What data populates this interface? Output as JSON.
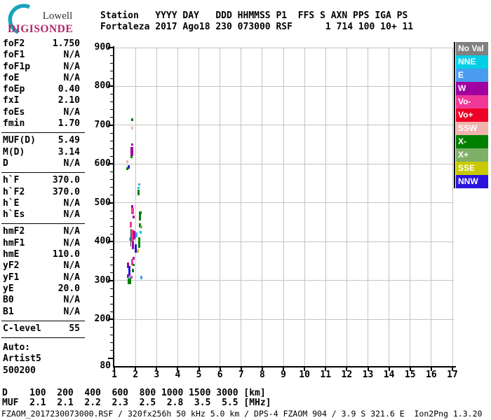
{
  "logo": {
    "line1": "Lowell",
    "line2": "DIGISONDE",
    "arc_color": "#1aa2bc",
    "digisonde_color": "#b02a68"
  },
  "header": {
    "line1": "Station   YYYY DAY   DDD HHMMSS P1  FFS S AXN PPS IGA PS",
    "line2": "Fortaleza 2017 Ago18 230 073000 RSF      1 714 100 10+ 11"
  },
  "params": {
    "groups": [
      {
        "rows": [
          {
            "label": "foF2",
            "value": "1.750"
          },
          {
            "label": "foF1",
            "value": "N/A"
          },
          {
            "label": "foF1p",
            "value": "N/A"
          },
          {
            "label": "foE",
            "value": "N/A"
          },
          {
            "label": "foEp",
            "value": "0.40"
          },
          {
            "label": "fxI",
            "value": "2.10"
          },
          {
            "label": "foEs",
            "value": "N/A"
          },
          {
            "label": "fmin",
            "value": "1.70"
          }
        ]
      },
      {
        "rows": [
          {
            "label": "MUF(D)",
            "value": "5.49"
          },
          {
            "label": "M(D)",
            "value": "3.14"
          },
          {
            "label": "D",
            "value": "N/A"
          }
        ]
      },
      {
        "rows": [
          {
            "label": "h`F",
            "value": "370.0"
          },
          {
            "label": "h`F2",
            "value": "370.0"
          },
          {
            "label": "h`E",
            "value": "N/A"
          },
          {
            "label": "h`Es",
            "value": "N/A"
          }
        ]
      },
      {
        "rows": [
          {
            "label": "hmF2",
            "value": "N/A"
          },
          {
            "label": "hmF1",
            "value": "N/A"
          },
          {
            "label": "hmE",
            "value": "110.0"
          },
          {
            "label": "yF2",
            "value": "N/A"
          },
          {
            "label": "yF1",
            "value": "N/A"
          },
          {
            "label": "yE",
            "value": "20.0"
          },
          {
            "label": "B0",
            "value": "N/A"
          },
          {
            "label": "B1",
            "value": "N/A"
          }
        ]
      },
      {
        "rows": [
          {
            "label": "C-level",
            "value": "55"
          }
        ]
      },
      {
        "rows": [
          {
            "label": "Auto:",
            "value": ""
          },
          {
            "label": "Artist5",
            "value": ""
          },
          {
            "label": "500200",
            "value": ""
          }
        ]
      }
    ]
  },
  "legend": {
    "items": [
      {
        "label": "No Val",
        "color": "#808080"
      },
      {
        "label": "NNE",
        "color": "#00cfe6"
      },
      {
        "label": "E",
        "color": "#4a9cf0"
      },
      {
        "label": "W",
        "color": "#a000a0"
      },
      {
        "label": "Vo-",
        "color": "#f03898"
      },
      {
        "label": "Vo+",
        "color": "#ef0028"
      },
      {
        "label": "SSW",
        "color": "#f0b3ad"
      },
      {
        "label": "X-",
        "color": "#008000"
      },
      {
        "label": "X+",
        "color": "#7fb068"
      },
      {
        "label": "SSE",
        "color": "#c9c900"
      },
      {
        "label": "NNW",
        "color": "#2a14dc"
      }
    ]
  },
  "footer": {
    "d_line": "D    100  200  400  600  800 1000 1500 3000 [km]",
    "muf_line": "MUF  2.1  2.1  2.2  2.3  2.5  2.8  3.5  5.5 [MHz]",
    "status_line": "FZAOM_2017230073000.RSF / 320fx256h 50 kHz 5.0 km / DPS-4 FZAOM 904 / 3.9 S 321.6 E  Ion2Png 1.3.20"
  },
  "chart_data": {
    "type": "scatter",
    "title": "Fortaleza ionogram 2017 Ago18 230 073000",
    "x_unit": "MHz",
    "y_unit": "km",
    "xlim": [
      1,
      17
    ],
    "ylim": [
      80,
      900
    ],
    "grid": true,
    "x_ticks": [
      1,
      2,
      3,
      4,
      5,
      6,
      7,
      8,
      9,
      10,
      11,
      12,
      13,
      14,
      15,
      16,
      17
    ],
    "y_ticks": [
      900,
      800,
      700,
      600,
      500,
      400,
      300,
      200,
      80
    ],
    "legend_position": "right",
    "colors": {
      "NoVal": "#808080",
      "NNE": "#00cfe6",
      "E": "#4a9cf0",
      "W": "#a000a0",
      "Vo-": "#f03898",
      "Vo+": "#ef0028",
      "SSW": "#f0b3ad",
      "X-": "#008000",
      "X+": "#7fb068",
      "SSE": "#c9c900",
      "NNW": "#2a14dc",
      "marker": "#3a3a3a"
    },
    "echoes": [
      {
        "f": 1.86,
        "top": 718,
        "bot": 711,
        "dir": "X-"
      },
      {
        "f": 1.86,
        "top": 697,
        "bot": 690,
        "dir": "SSW"
      },
      {
        "f": 1.84,
        "top": 653,
        "bot": 647,
        "dir": "W"
      },
      {
        "f": 1.83,
        "top": 644,
        "bot": 620,
        "dir": "W",
        "w": 4
      },
      {
        "f": 1.8,
        "top": 622,
        "bot": 615,
        "dir": "X-"
      },
      {
        "f": 1.63,
        "top": 610,
        "bot": 603,
        "dir": "SSW"
      },
      {
        "f": 1.69,
        "top": 597,
        "bot": 588,
        "dir": "NNW"
      },
      {
        "f": 1.62,
        "top": 592,
        "bot": 584,
        "dir": "X-"
      },
      {
        "f": 2.17,
        "top": 551,
        "bot": 545,
        "dir": "E"
      },
      {
        "f": 2.16,
        "top": 542,
        "bot": 536,
        "dir": "NNE"
      },
      {
        "f": 2.13,
        "top": 534,
        "bot": 520,
        "dir": "X-"
      },
      {
        "f": 1.84,
        "top": 495,
        "bot": 484,
        "dir": "W"
      },
      {
        "f": 1.85,
        "top": 487,
        "bot": 471,
        "dir": "Vo-",
        "w": 4
      },
      {
        "f": 2.26,
        "top": 478,
        "bot": 471,
        "dir": "X-"
      },
      {
        "f": 2.2,
        "top": 479,
        "bot": 455,
        "dir": "X-"
      },
      {
        "f": 1.92,
        "top": 467,
        "bot": 460,
        "dir": "W"
      },
      {
        "f": 1.77,
        "top": 452,
        "bot": 437,
        "dir": "Vo-"
      },
      {
        "f": 2.2,
        "top": 448,
        "bot": 436,
        "dir": "X-"
      },
      {
        "f": 2.29,
        "top": 442,
        "bot": 435,
        "dir": "X+"
      },
      {
        "f": 2.23,
        "top": 427,
        "bot": 420,
        "dir": "NNE"
      },
      {
        "f": 2.06,
        "top": 424,
        "bot": 412,
        "dir": "E"
      },
      {
        "f": 1.85,
        "top": 431,
        "bot": 400,
        "dir": "Vo-",
        "w": 4
      },
      {
        "f": 1.95,
        "top": 428,
        "bot": 407,
        "dir": "W"
      },
      {
        "f": 1.76,
        "top": 412,
        "bot": 403,
        "dir": "NNE"
      },
      {
        "f": 2.17,
        "top": 411,
        "bot": 384,
        "dir": "X-"
      },
      {
        "f": 1.87,
        "top": 400,
        "bot": 381,
        "dir": "W"
      },
      {
        "f": 2.0,
        "top": 394,
        "bot": 372,
        "dir": "NNW"
      },
      {
        "f": 2.12,
        "top": 381,
        "bot": 372,
        "dir": "SSE"
      },
      {
        "f": 1.92,
        "top": 361,
        "bot": 354,
        "dir": "W"
      },
      {
        "f": 1.84,
        "top": 356,
        "bot": 348,
        "dir": "Vo-"
      },
      {
        "f": 1.65,
        "top": 346,
        "bot": 332,
        "dir": "W"
      },
      {
        "f": 1.83,
        "top": 349,
        "bot": 340,
        "dir": "Vo-"
      },
      {
        "f": 1.92,
        "top": 344,
        "bot": 337,
        "dir": "X-"
      },
      {
        "f": 1.72,
        "top": 337,
        "bot": 312,
        "dir": "NNW"
      },
      {
        "f": 1.87,
        "top": 331,
        "bot": 321,
        "dir": "X-"
      },
      {
        "f": 1.65,
        "top": 316,
        "bot": 307,
        "dir": "W"
      },
      {
        "f": 1.72,
        "top": 311,
        "bot": 303,
        "dir": "NNE"
      },
      {
        "f": 1.81,
        "top": 312,
        "bot": 305,
        "dir": "Vo-"
      },
      {
        "f": 1.7,
        "top": 305,
        "bot": 291,
        "dir": "X-",
        "w": 5
      },
      {
        "f": 2.28,
        "top": 312,
        "bot": 304,
        "dir": "E"
      },
      {
        "f": 1.78,
        "top": 434,
        "bot": 388,
        "dir": "marker",
        "w": 1
      }
    ],
    "muf_table": {
      "distance_km": [
        100,
        200,
        400,
        600,
        800,
        1000,
        1500,
        3000
      ],
      "muf_mhz": [
        2.1,
        2.1,
        2.2,
        2.3,
        2.5,
        2.8,
        3.5,
        5.5
      ]
    }
  }
}
